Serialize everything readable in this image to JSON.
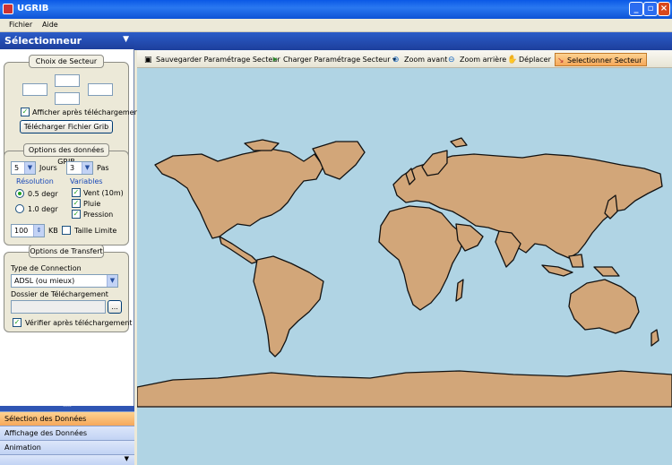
{
  "window": {
    "title": "UGRIB"
  },
  "menu": {
    "file": "Fichier",
    "help": "Aide"
  },
  "sidebar": {
    "header": "Sélectionneur",
    "sector_group": {
      "title": "Choix de Secteur",
      "show_after_download": "Afficher après téléchargement",
      "download_button": "Télécharger Fichier Grib"
    },
    "grib_group": {
      "title": "Options des données GRIB",
      "days_value": "5",
      "days_label": "Jours",
      "step_value": "3",
      "step_label": "Pas",
      "resolution_label": "Résolution",
      "res_05": "0.5 degr",
      "res_10": "1.0 degr",
      "variables_label": "Variables",
      "var_wind": "Vent (10m)",
      "var_rain": "Pluie",
      "var_pressure": "Pression",
      "size_value": "100",
      "size_unit": "KB",
      "size_limit": "Taille Limite"
    },
    "transfer_group": {
      "title": "Options de Transfert",
      "connection_label": "Type de Connection",
      "connection_value": "ADSL (ou mieux)",
      "folder_label": "Dossier de Téléchargement",
      "browse_button": "...",
      "verify_after": "Vérifier après téléchargement"
    },
    "nav": [
      "Sélection des Données",
      "Affichage des Données",
      "Animation"
    ]
  },
  "toolbar": {
    "save": "Sauvegarder Paramétrage Secteur",
    "load": "Charger Paramétrage Secteur",
    "zoom_in": "Zoom avant",
    "zoom_out": "Zoom arrière",
    "move": "Déplacer",
    "select": "Selectionner Secteur"
  },
  "colors": {
    "ocean": "#b0d4e4",
    "land": "#d2a679",
    "accent": "#f6a85a"
  }
}
